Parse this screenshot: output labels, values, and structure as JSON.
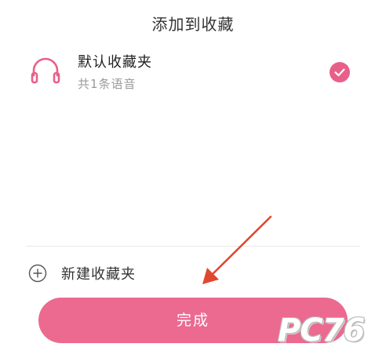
{
  "sheet": {
    "title": "添加到收藏"
  },
  "folders": [
    {
      "name": "默认收藏夹",
      "count_text": "共1条语音",
      "icon": "headphones-icon",
      "selected": true
    }
  ],
  "new_folder": {
    "label": "新建收藏夹",
    "icon": "plus-circle-icon"
  },
  "done_button": {
    "label": "完成"
  },
  "annotation": {
    "arrow_color": "#e0472f"
  },
  "watermark": {
    "text": "PC76"
  },
  "colors": {
    "accent": "#ec6990",
    "check": "#e8608a",
    "secondary_text": "#9a9a9a"
  }
}
